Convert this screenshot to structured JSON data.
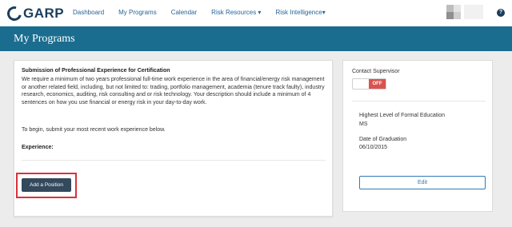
{
  "nav": {
    "logo": "GARP",
    "items": [
      "Dashboard",
      "My Programs",
      "Calendar",
      "Risk Resources ▾",
      "Risk Intelligence▾"
    ],
    "help": "?"
  },
  "banner": {
    "title": "My Programs"
  },
  "main": {
    "heading": "Submission of Professional Experience for Certification",
    "body": "We require a minimum of two years professional full-time work experience in the area of financial/energy risk management or another related field, including, but not limited to: trading, portfolio management, academia (tenure track faulty), industry research, economics, auditing, risk consulting and or risk technology. Your description should include a minimum of 4 sentences on how you use financial or energy risk in your day-to-day work.",
    "begin": "To begin, submit your most recent work experience below.",
    "experience_label": "Experience:",
    "add_button": "Add a Position"
  },
  "side": {
    "contact_label": "Contact Supervisor",
    "toggle_state": "OFF",
    "education_label": "Highest Level of Formal Education",
    "education_value": "MS",
    "grad_label": "Date of Graduation",
    "grad_value": "06/10/2015",
    "edit_button": "Edit"
  },
  "colors": {
    "brand": "#1b3d5c",
    "banner": "#1a6d8e",
    "link": "#2a6496",
    "danger": "#d9534f"
  },
  "icons": {
    "logo": "garp-logo-icon",
    "help": "help-icon",
    "avatar": "user-avatar"
  }
}
